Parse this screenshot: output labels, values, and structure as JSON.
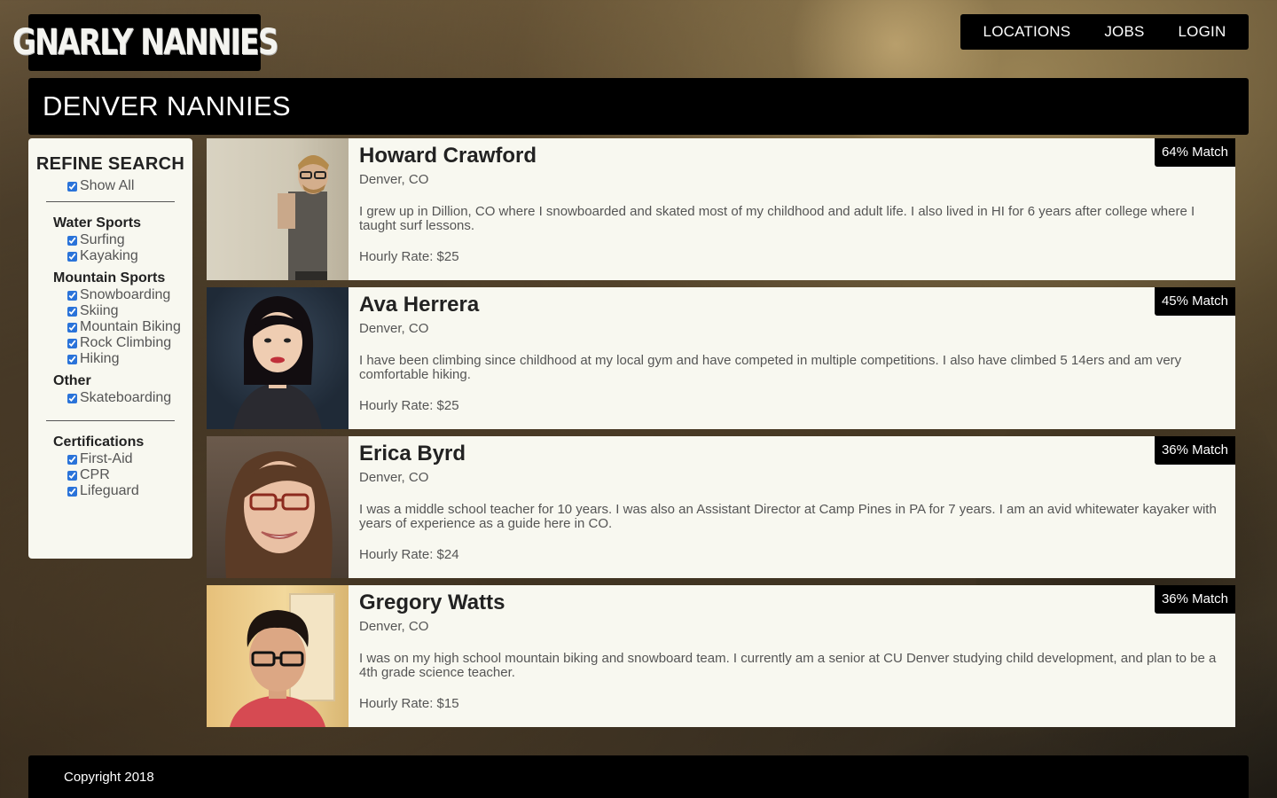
{
  "brand": {
    "logo_text": "GNARLY NANNIES"
  },
  "nav": {
    "items": [
      {
        "label": "LOCATIONS"
      },
      {
        "label": "JOBS"
      },
      {
        "label": "LOGIN"
      }
    ]
  },
  "page": {
    "title": "DENVER NANNIES"
  },
  "sidebar": {
    "title": "REFINE SEARCH",
    "show_all": {
      "label": "Show All",
      "checked": true
    },
    "groups": [
      {
        "title": "Water Sports",
        "options": [
          {
            "label": "Surfing",
            "checked": true
          },
          {
            "label": "Kayaking",
            "checked": true
          }
        ]
      },
      {
        "title": "Mountain Sports",
        "options": [
          {
            "label": "Snowboarding",
            "checked": true
          },
          {
            "label": "Skiing",
            "checked": true
          },
          {
            "label": "Mountain Biking",
            "checked": true
          },
          {
            "label": "Rock Climbing",
            "checked": true
          },
          {
            "label": "Hiking",
            "checked": true
          }
        ]
      },
      {
        "title": "Other",
        "options": [
          {
            "label": "Skateboarding",
            "checked": true
          }
        ]
      }
    ],
    "certifications": {
      "title": "Certifications",
      "options": [
        {
          "label": "First-Aid",
          "checked": true
        },
        {
          "label": "CPR",
          "checked": true
        },
        {
          "label": "Lifeguard",
          "checked": true
        }
      ]
    }
  },
  "nannies": [
    {
      "name": "Howard Crawford",
      "location": "Denver, CO",
      "bio": "I grew up in Dillion, CO where I snowboarded and skated most of my childhood and adult life. I also lived in HI for 6 years after college where I taught surf lessons.",
      "rate": "Hourly Rate: $25",
      "match": "64% Match"
    },
    {
      "name": "Ava Herrera",
      "location": "Denver, CO",
      "bio": "I have been climbing since childhood at my local gym and have competed in multiple competitions. I also have climbed 5 14ers and am very comfortable hiking.",
      "rate": "Hourly Rate: $25",
      "match": "45% Match"
    },
    {
      "name": "Erica Byrd",
      "location": "Denver, CO",
      "bio": "I was a middle school teacher for 10 years. I was also an Assistant Director at Camp Pines in PA for 7 years. I am an avid whitewater kayaker with years of experience as a guide here in CO.",
      "rate": "Hourly Rate: $24",
      "match": "36% Match"
    },
    {
      "name": "Gregory Watts",
      "location": "Denver, CO",
      "bio": "I was on my high school mountain biking and snowboard team. I currently am a senior at CU Denver studying child development, and plan to be a 4th grade science teacher.",
      "rate": "Hourly Rate: $15",
      "match": "36% Match"
    }
  ],
  "footer": {
    "copyright": "Copyright 2018"
  },
  "colors": {
    "panel_bg": "#f8f8f0",
    "bar_bg": "#000000",
    "checkbox_accent": "#2a73d9"
  }
}
